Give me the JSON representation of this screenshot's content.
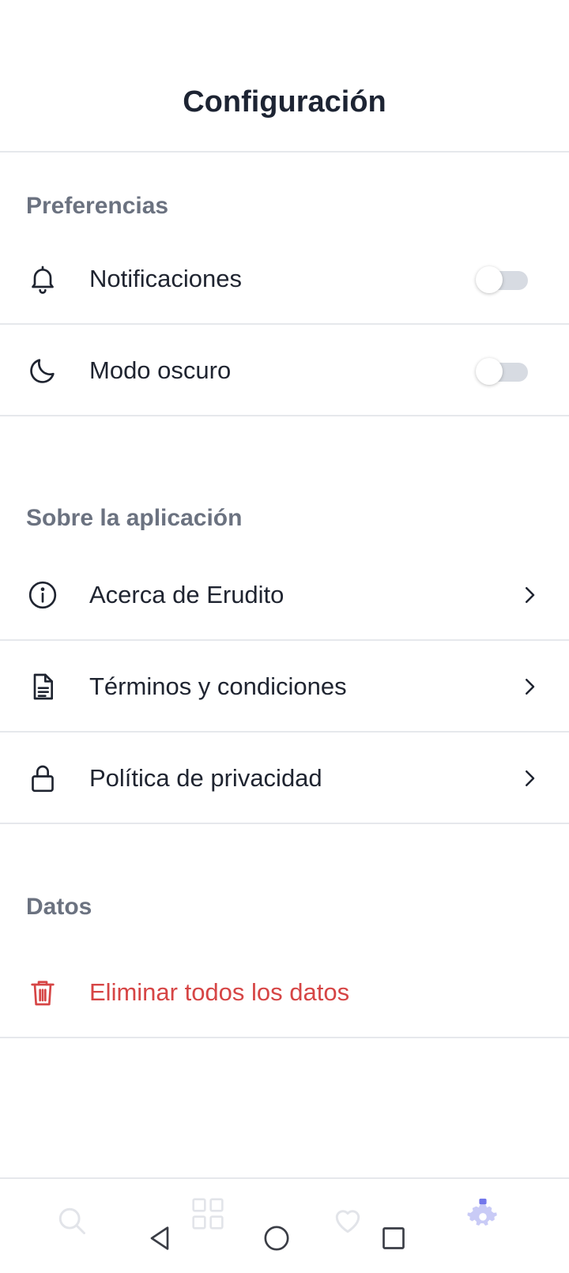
{
  "header": {
    "title": "Configuración"
  },
  "sections": [
    {
      "label": "Preferencias",
      "items": [
        {
          "label": "Notificaciones",
          "icon": "bell-icon",
          "toggle": false
        },
        {
          "label": "Modo oscuro",
          "icon": "moon-icon",
          "toggle": false
        }
      ]
    },
    {
      "label": "Sobre la aplicación",
      "items": [
        {
          "label": "Acerca de Erudito",
          "icon": "info-icon"
        },
        {
          "label": "Términos y condiciones",
          "icon": "document-icon"
        },
        {
          "label": "Política de privacidad",
          "icon": "lock-icon"
        }
      ]
    },
    {
      "label": "Datos",
      "items": [
        {
          "label": "Eliminar todos los datos",
          "icon": "trash-icon"
        }
      ]
    }
  ],
  "bottom_nav": {
    "tabs": [
      "search-icon",
      "grid-icon",
      "heart-icon",
      "gear-icon"
    ],
    "active": "gear-icon"
  },
  "system_nav": [
    "back-icon",
    "home-icon",
    "recents-icon"
  ],
  "colors": {
    "text": "#1f2430",
    "section_label": "#6b7280",
    "danger": "#d64545",
    "divider": "#e6e8ec",
    "toggle_off": "#d7dbe2",
    "active_tab": "#5b5fe8"
  }
}
